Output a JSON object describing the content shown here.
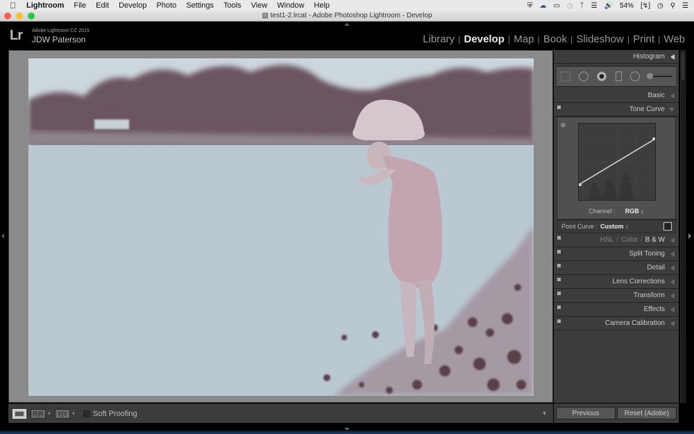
{
  "menubar": {
    "apple_icon": "",
    "items": [
      "Lightroom",
      "File",
      "Edit",
      "Develop",
      "Photo",
      "Settings",
      "Tools",
      "View",
      "Window",
      "Help"
    ],
    "status": {
      "battery_percent": "54%"
    }
  },
  "window": {
    "title": "test1-2.lrcat - Adobe Photoshop Lightroom - Develop"
  },
  "identity_plate": {
    "product": "Adobe Lightroom CC 2015",
    "name": "JDW Paterson",
    "logo": "Lr"
  },
  "modules": {
    "items": [
      "Library",
      "Develop",
      "Map",
      "Book",
      "Slideshow",
      "Print",
      "Web"
    ],
    "active": "Develop"
  },
  "toolbar": {
    "loupe_icon": "loupe-view",
    "before_after_lr": "R|R",
    "before_after_y": "Y|Y",
    "soft_proofing_label": "Soft Proofing",
    "soft_proofing_checked": false
  },
  "right_panel": {
    "histogram_label": "Histogram",
    "basic_label": "Basic",
    "tone_curve_label": "Tone Curve",
    "tone_curve": {
      "channel_label": "Channel :",
      "channel_value": "RGB",
      "point_curve_label": "Point Curve :",
      "point_curve_value": "Custom",
      "curve_points": [
        [
          0.0,
          0.2
        ],
        [
          1.0,
          0.8
        ]
      ]
    },
    "hsl": {
      "hsl": "HSL",
      "color": "Color",
      "bw": "B & W",
      "sep": "/"
    },
    "sections": [
      "Split Toning",
      "Detail",
      "Lens Corrections",
      "Transform",
      "Effects",
      "Camera Calibration"
    ]
  },
  "buttons": {
    "previous": "Previous",
    "reset": "Reset (Adobe)"
  }
}
